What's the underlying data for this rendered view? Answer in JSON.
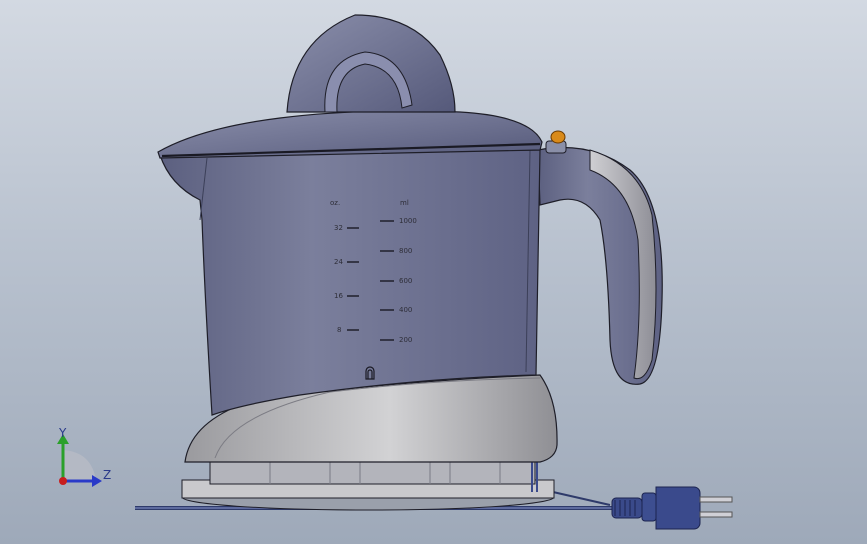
{
  "scale": {
    "unit_left": "oz.",
    "unit_right": "ml",
    "oz_marks": [
      "32",
      "24",
      "16",
      "8"
    ],
    "ml_marks": [
      "1000",
      "800",
      "600",
      "400",
      "200"
    ]
  },
  "triad": {
    "y_label": "Y",
    "z_label": "Z"
  },
  "colors": {
    "jug": "#6e7391",
    "base": "#bcbcbc",
    "handle_grip": "#b4b4b8",
    "button": "#d98a1a",
    "triad_y": "#2aa02a",
    "triad_z": "#2a3ac8"
  }
}
